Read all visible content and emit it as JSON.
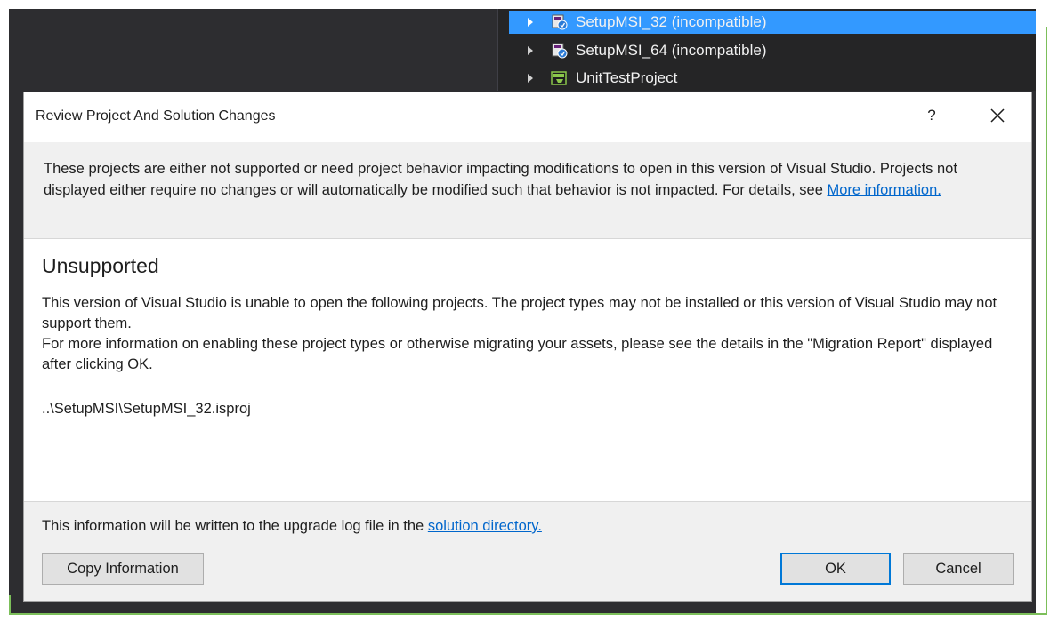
{
  "solution_explorer": {
    "items": [
      {
        "label": "SetupMSI_32 (incompatible)",
        "selected": true,
        "icon": "setup-project-icon"
      },
      {
        "label": "SetupMSI_64 (incompatible)",
        "selected": false,
        "icon": "setup-project-icon"
      },
      {
        "label": "UnitTestProject",
        "selected": false,
        "icon": "test-project-icon"
      }
    ]
  },
  "dialog": {
    "title": "Review Project And Solution Changes",
    "help_label": "?",
    "info": {
      "text": "These projects are either not supported or need project behavior impacting modifications to open in this version of Visual Studio. Projects not displayed either require no changes or will automatically be modified such that behavior is not impacted. For details, see ",
      "link": "More information."
    },
    "unsupported": {
      "heading": "Unsupported",
      "line1": "This version of Visual Studio is unable to open the following projects. The project types may not be installed or this version of Visual Studio may not support them.",
      "line2": "For more information on enabling these project types or otherwise migrating your assets, please see the details in the \"Migration Report\" displayed after clicking OK.",
      "project_path": "..\\SetupMSI\\SetupMSI_32.isproj"
    },
    "footer": {
      "text": "This information will be written to the upgrade log file in the ",
      "link": "solution directory."
    },
    "buttons": {
      "copy": "Copy Information",
      "ok": "OK",
      "cancel": "Cancel"
    }
  },
  "colors": {
    "vs_dark": "#2d2d30",
    "selection": "#3399ff",
    "link": "#0066cc",
    "ok_border": "#0078d7",
    "frame_green": "#7cbf5a"
  }
}
